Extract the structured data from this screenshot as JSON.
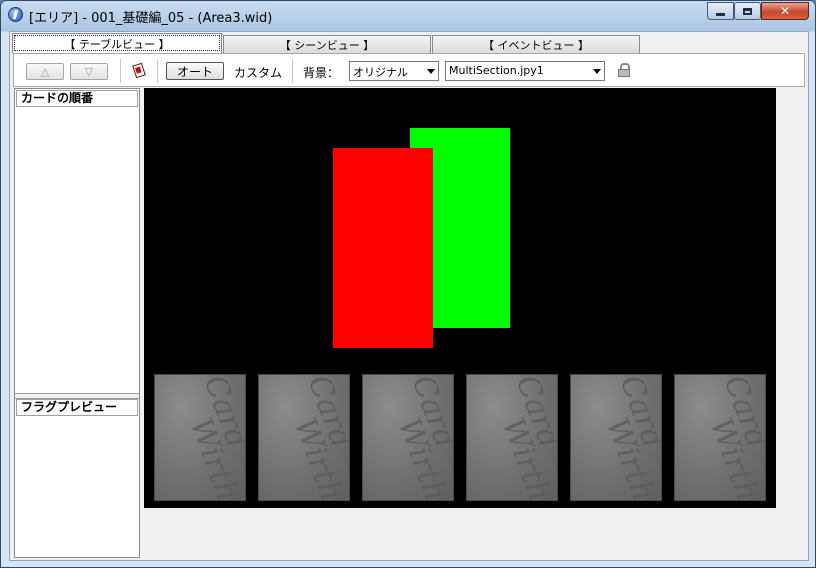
{
  "window": {
    "title": "[エリア] - 001_基礎編_05 - (Area3.wid)"
  },
  "tabs": [
    {
      "label": "【 テーブルビュー 】",
      "active": true
    },
    {
      "label": "【 シーンビュー 】",
      "active": false
    },
    {
      "label": "【 イベントビュー 】",
      "active": false
    }
  ],
  "toolbar": {
    "up_label": "△",
    "down_label": "▽",
    "auto_label": "オート",
    "custom_label": "カスタム",
    "background_label": "背景：",
    "background_select": "オリジナル",
    "image_select": "MultiSection.jpy1"
  },
  "left_panel": {
    "card_order_title": "カードの順番",
    "flag_preview_title": "フラグプレビュー"
  },
  "table": {
    "colors": {
      "background": "#000000",
      "red": "#ff0000",
      "green": "#00ff00",
      "card": "#7a7a7a"
    },
    "card_back_text": [
      "Card",
      "Wirth"
    ],
    "card_slots": 6
  }
}
